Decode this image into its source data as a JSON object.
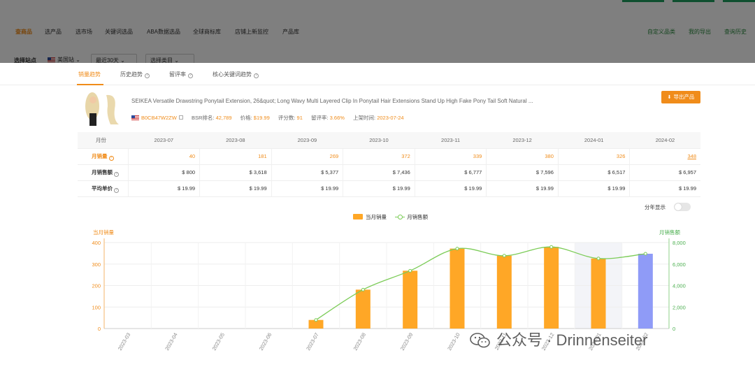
{
  "background": {
    "nav": {
      "items": [
        "查商品",
        "选产品",
        "选市场",
        "关键词选品",
        "ABA数据选品",
        "全球商标库",
        "店铺上新监控",
        "产品库"
      ],
      "right_items": [
        "自定义品类",
        "我的导出",
        "查询历史"
      ]
    },
    "filter": {
      "label": "选择站点",
      "site": "美国站",
      "period": "最近30天",
      "category": "选择类目"
    }
  },
  "tabs": [
    "销量趋势",
    "历史趋势",
    "留评率",
    "核心关键词趋势"
  ],
  "product": {
    "title": "SEIKEA Versatile Drawstring Ponytail Extension, 26&quot; Long Wavy Multi Layered Clip In Ponytail Hair Extensions Stand Up High Fake Pony Tail Soft Natural ...",
    "asin": "B0CB47W2ZW",
    "bsr_label": "BSR排名:",
    "bsr": "42,789",
    "price_label": "价格:",
    "price": "$19.99",
    "rating_count_label": "评分数:",
    "rating_count": "91",
    "review_rate_label": "留评率:",
    "review_rate": "3.66%",
    "launch_label": "上架时间:",
    "launch_date": "2023-07-24",
    "export_label": "导出产品"
  },
  "table": {
    "header_label": "月份",
    "months": [
      "2023-07",
      "2023-08",
      "2023-09",
      "2023-10",
      "2023-11",
      "2023-12",
      "2024-01",
      "2024-02"
    ],
    "rows": [
      {
        "label": "月销量",
        "values": [
          "40",
          "181",
          "269",
          "372",
          "339",
          "380",
          "326",
          "348"
        ]
      },
      {
        "label": "月销售额",
        "values": [
          "$ 800",
          "$ 3,618",
          "$ 5,377",
          "$ 7,436",
          "$ 6,777",
          "$ 7,596",
          "$ 6,517",
          "$ 6,957"
        ]
      },
      {
        "label": "平均单价",
        "values": [
          "$ 19.99",
          "$ 19.99",
          "$ 19.99",
          "$ 19.99",
          "$ 19.99",
          "$ 19.99",
          "$ 19.99",
          "$ 19.99"
        ]
      }
    ]
  },
  "toggle_label": "分年显示",
  "watermark": "公众号 · Drinnenseiter",
  "chart_data": {
    "type": "bar",
    "categories": [
      "2023-03",
      "2023-04",
      "2023-05",
      "2023-06",
      "2023-07",
      "2023-08",
      "2023-09",
      "2023-10",
      "2023-11",
      "2023-12",
      "2024-01",
      "2024-02"
    ],
    "series": [
      {
        "name": "当月销量",
        "type": "bar",
        "axis": "left",
        "values": [
          null,
          null,
          null,
          null,
          40,
          181,
          269,
          372,
          339,
          380,
          326,
          348
        ],
        "color": "#ffa726",
        "highlight_color": "#8f9bf7",
        "highlight_index": 11
      },
      {
        "name": "月销售额",
        "type": "line",
        "axis": "right",
        "values": [
          null,
          null,
          null,
          null,
          800,
          3618,
          5377,
          7436,
          6777,
          7596,
          6517,
          6957
        ],
        "color": "#7ccc58"
      }
    ],
    "ylabel": "当月销量",
    "ylabel_right": "月销售额",
    "ylim": [
      0,
      400
    ],
    "yticks": [
      "0",
      "100",
      "200",
      "300",
      "400"
    ],
    "ylim_right": [
      0,
      8000
    ],
    "yticks_right": [
      "0",
      "2,000",
      "4,000",
      "6,000",
      "8,000"
    ],
    "hover_index": 10,
    "legend_position": "top-center"
  }
}
